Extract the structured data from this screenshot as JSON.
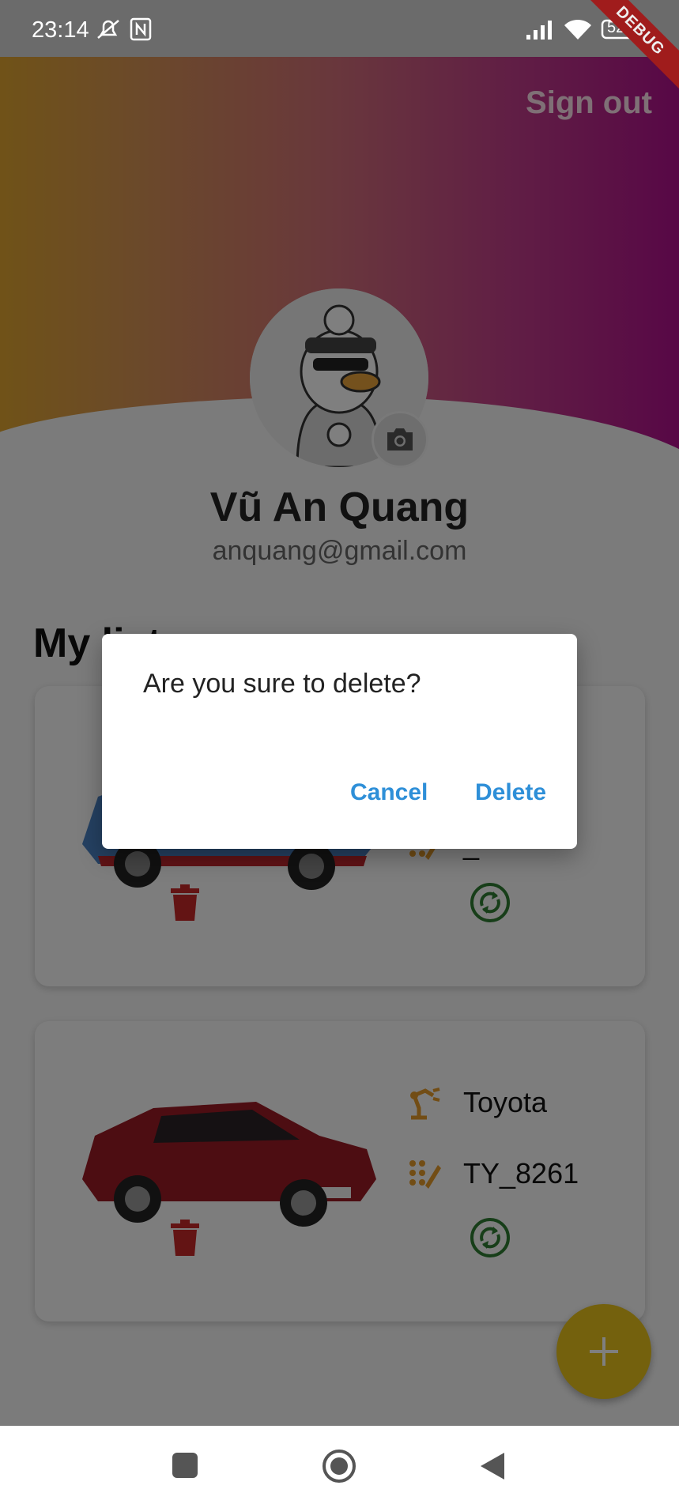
{
  "status_bar": {
    "time": "23:14",
    "battery": "52"
  },
  "debug_banner": "DEBUG",
  "header": {
    "sign_out_label": "Sign out"
  },
  "profile": {
    "name": "Vũ An Quang",
    "email": "anquang@gmail.com"
  },
  "list": {
    "title": "My list",
    "cars": [
      {
        "brand": "",
        "code": "_",
        "color": "#4a82c4"
      },
      {
        "brand": "Toyota",
        "code": "TY_8261",
        "color": "#9b1b24"
      }
    ]
  },
  "dialog": {
    "message": "Are you sure to delete?",
    "cancel_label": "Cancel",
    "delete_label": "Delete"
  },
  "icons": {
    "brand": "robot-arm-icon",
    "code": "pattern-icon",
    "delete": "trash-icon",
    "update": "sync-icon",
    "add": "plus-icon"
  },
  "colors": {
    "accent_blue": "#2e8fd8",
    "delete_red": "#c62828",
    "sync_green": "#2e7d32",
    "fab_yellow": "#e8c21a",
    "icon_orange": "#e59a2a"
  }
}
